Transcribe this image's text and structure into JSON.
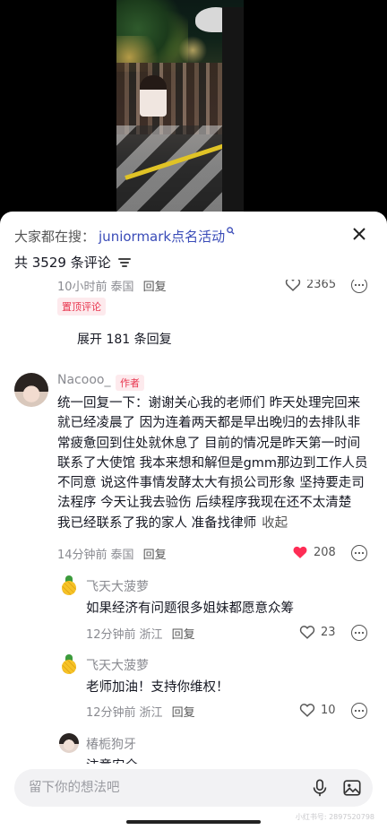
{
  "header": {
    "search_prefix": "大家都在搜：",
    "search_term": "juniormark点名活动",
    "comment_count": "共 3529 条评论"
  },
  "comments": {
    "pinned": {
      "time": "10小时前",
      "location": "泰国",
      "reply_label": "回复",
      "likes": "2365",
      "badge": "置顶评论",
      "expand": "展开 181 条回复"
    },
    "main": {
      "username": "Nacooo_",
      "author_badge": "作者",
      "lines": [
        "统一回复一下：谢谢关心我的老师们 昨天处理完回来",
        "就已经凌晨了 因为连着两天都是早出晚归的去排队非",
        "常疲惫回到住处就休息了 目前的情况是昨天第一时间",
        "联系了大使馆 我本来想和解但是gmm那边到工作人员",
        "不同意 说这件事情发酵太大有损公司形象 坚持要走司",
        "法程序 今天让我去验伤 后续程序我现在还不太清楚",
        "我已经联系了我的家人 准备找律师"
      ],
      "collapse_label": "收起",
      "time": "14分钟前",
      "location": "泰国",
      "reply_label": "回复",
      "likes": "208",
      "liked_color": "#fe2c55"
    },
    "replies": [
      {
        "username": "飞天大菠萝",
        "text": "如果经济有问题很多姐妹都愿意众筹",
        "time": "12分钟前",
        "location": "浙江",
        "reply_label": "回复",
        "likes": "23",
        "avatar_icon": "pineapple-icon"
      },
      {
        "username": "飞天大菠萝",
        "text": "老师加油！支持你维权！",
        "time": "12分钟前",
        "location": "浙江",
        "reply_label": "回复",
        "likes": "10",
        "avatar_icon": "pineapple-icon"
      },
      {
        "username": "椿栀狗牙",
        "text": "注意安全",
        "avatar_icon": "avatar-girl"
      }
    ]
  },
  "input": {
    "placeholder": "留下你的想法吧"
  },
  "watermark": "小红书号: 2897520798"
}
